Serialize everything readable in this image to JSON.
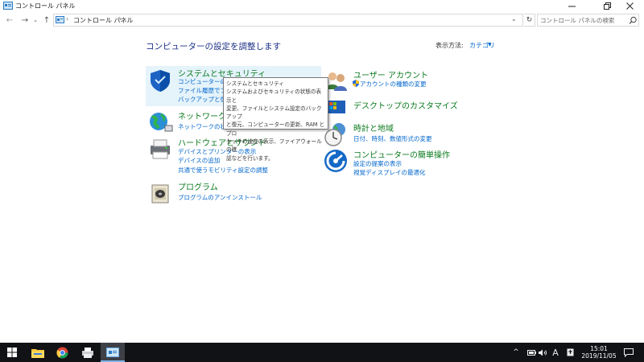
{
  "window": {
    "title": "コントロール パネル"
  },
  "address": {
    "crumb": "コントロール パネル",
    "search_placeholder": "コントロール パネルの検索"
  },
  "main": {
    "heading": "コンピューターの設定を調整します",
    "view_by_label": "表示方法:",
    "view_by_value": "カテゴリ"
  },
  "categories": {
    "system_security": {
      "title": "システムとセキュリティ",
      "links": [
        "コンピューターの状態を確認",
        "ファイル履歴でファイル",
        "バックアップと復元 (W"
      ]
    },
    "network": {
      "title": "ネットワークとイ",
      "links": [
        "ネットワークの状態と"
      ]
    },
    "hardware": {
      "title": "ハードウェアとサウンド",
      "links": [
        "デバイスとプリンターの表示",
        "デバイスの追加",
        "共通で使うモビリティ設定の調整"
      ]
    },
    "programs": {
      "title": "プログラム",
      "links": [
        "プログラムのアンインストール"
      ]
    },
    "user_accounts": {
      "title": "ユーザー アカウント",
      "links": [
        "アカウントの種類の変更"
      ]
    },
    "appearance": {
      "title": "デスクトップのカスタマイズ",
      "links": []
    },
    "clock": {
      "title": "時計と地域",
      "links": [
        "日付、時刻、数値形式の変更"
      ]
    },
    "ease": {
      "title": "コンピューターの簡単操作",
      "links": [
        "設定の提案の表示",
        "視覚ディスプレイの最適化"
      ]
    }
  },
  "tooltip": {
    "lines": [
      "システムとセキュリティ",
      "システムおよびセキュリティの状態の表示と",
      "変更、ファイルとシステム設定のバックアップ",
      "と復元、コンピューターの更新、RAM とプロ",
      "セッサの速度の表示、ファイアウォールの確",
      "認などを行います。"
    ]
  },
  "taskbar": {
    "time": "15:01",
    "date": "2019/11/05",
    "ime": "A"
  },
  "colors": {
    "category_title": "#0a7a1d",
    "link": "#0066cc",
    "heading": "#1e3287",
    "taskbar": "#101216"
  }
}
